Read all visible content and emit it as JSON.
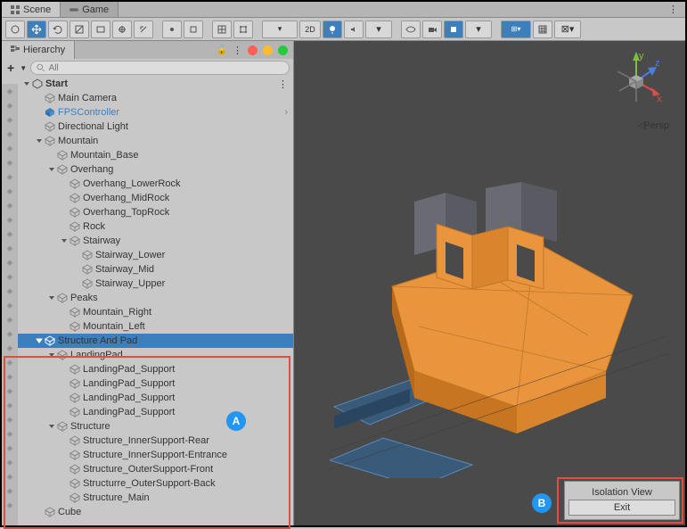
{
  "tabs": {
    "scene": "Scene",
    "game": "Game"
  },
  "hierarchy": {
    "title": "Hierarchy",
    "search_placeholder": "All"
  },
  "tree": {
    "root": "Start",
    "items": [
      "Main Camera",
      "FPSController",
      "Directional Light",
      "Mountain",
      "Mountain_Base",
      "Overhang",
      "Overhang_LowerRock",
      "Overhang_MidRock",
      "Overhang_TopRock",
      "Rock",
      "Stairway",
      "Stairway_Lower",
      "Stairway_Mid",
      "Stairway_Upper",
      "Peaks",
      "Mountain_Right",
      "Mountain_Left",
      "Structure And Pad",
      "LandingPad",
      "LandingPad_Support",
      "LandingPad_Support",
      "LandingPad_Support",
      "LandingPad_Support",
      "Structure",
      "Structure_InnerSupport-Rear",
      "Structure_InnerSupport-Entrance",
      "Structure_OuterSupport-Front",
      "Structurre_OuterSupport-Back",
      "Structure_Main",
      "Cube"
    ]
  },
  "viewport": {
    "persp": "Persp",
    "axes": {
      "x": "x",
      "y": "y",
      "z": "z"
    }
  },
  "isolation": {
    "title": "Isolation View",
    "exit": "Exit"
  },
  "badges": {
    "a": "A",
    "b": "B"
  }
}
